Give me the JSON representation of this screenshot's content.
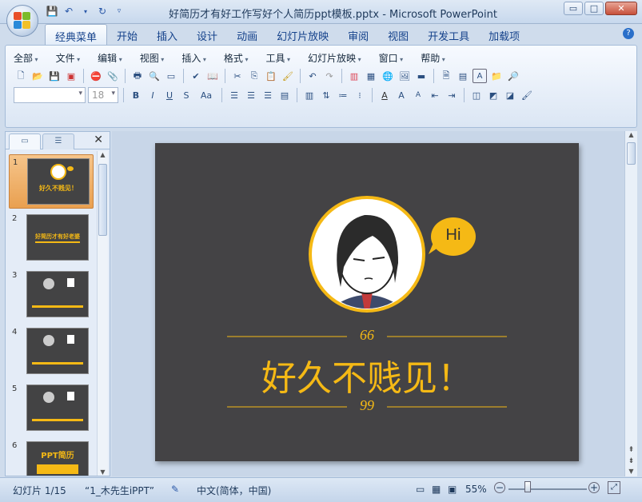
{
  "window": {
    "title": "好简历才有好工作写好个人简历ppt模板.pptx - Microsoft PowerPoint",
    "min": "▭",
    "max": "□",
    "close": "✕"
  },
  "ribbon_tabs": [
    "经典菜单",
    "开始",
    "插入",
    "设计",
    "动画",
    "幻灯片放映",
    "审阅",
    "视图",
    "开发工具",
    "加载项"
  ],
  "menu": [
    "全部",
    "文件",
    "编辑",
    "视图",
    "插入",
    "格式",
    "工具",
    "幻灯片放映",
    "窗口",
    "帮助"
  ],
  "font": {
    "size": "18"
  },
  "slides": [
    {
      "num": "1",
      "title": "好久不贱见！"
    },
    {
      "num": "2",
      "title": "好简历才有好老婆"
    },
    {
      "num": "3",
      "title": ""
    },
    {
      "num": "4",
      "title": ""
    },
    {
      "num": "5",
      "title": ""
    },
    {
      "num": "6",
      "title": "PPT简历"
    }
  ],
  "slide": {
    "bubble": "Hi",
    "quote_open": "66",
    "quote_close": "99",
    "headline": "好久不贱见！"
  },
  "status": {
    "slide_counter": "幻灯片 1/15",
    "theme": "“1_木先生iPPT”",
    "language": "中文(简体，中国)",
    "zoom": "55%"
  },
  "colors": {
    "accent": "#f5b915",
    "slide_bg": "#444345"
  }
}
